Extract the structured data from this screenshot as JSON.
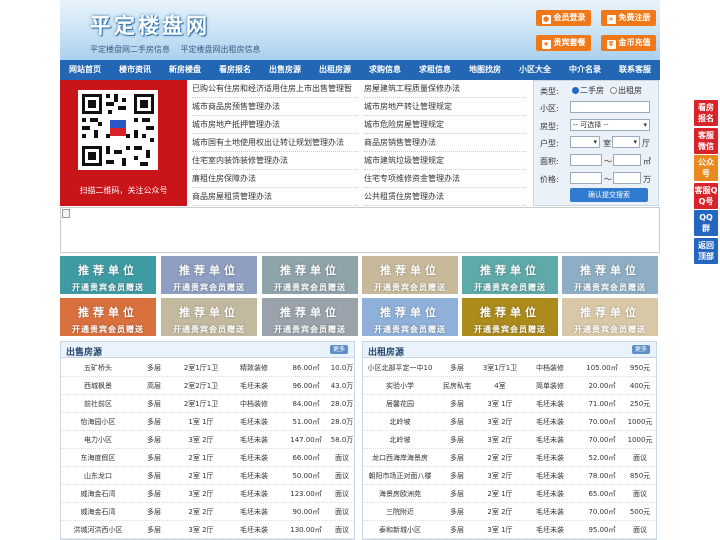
{
  "header": {
    "logo": "平定楼盘网",
    "subtitles": [
      "平定楼盘网二手房信息",
      "平定楼盘网出租房信息"
    ],
    "buttons": [
      {
        "label": "会员登录",
        "icon": "user-icon"
      },
      {
        "label": "免费注册",
        "icon": "register-icon"
      },
      {
        "label": "贵宾套餐",
        "icon": "vip-icon"
      },
      {
        "label": "金币充值",
        "icon": "coin-icon"
      }
    ]
  },
  "nav": [
    "网站首页",
    "楼市资讯",
    "新房楼盘",
    "看房报名",
    "出售房源",
    "出租房源",
    "求购信息",
    "求租信息",
    "地图找房",
    "小区大全",
    "中介名录",
    "联系客服"
  ],
  "qr": {
    "caption": "扫描二维码，关注公众号"
  },
  "links": {
    "left": [
      "已购公有住房和经济适用住房上市出售管理暂",
      "城市商品房预售管理办法",
      "城市房地产抵押管理办法",
      "城市国有土地使用权出让转让规划管理办法",
      "住宅室内装饰装修管理办法",
      "廉租住房保障办法",
      "商品房屋租赁管理办法"
    ],
    "right": [
      "房屋建筑工程质量保修办法",
      "城市房地产转让管理规定",
      "城市危险房屋管理规定",
      "商品房销售管理办法",
      "城市建筑垃圾管理规定",
      "住宅专项维修资金管理办法",
      "公共租赁住房管理办法"
    ]
  },
  "search": {
    "type_label": "类型:",
    "type_options": [
      "二手房",
      "出租房"
    ],
    "community_label": "小区:",
    "style_label": "房型:",
    "style_select": "-- 可选择 --",
    "layout_label": "户型:",
    "layout_unit1": "室",
    "layout_unit2": "厅",
    "area_label": "面积:",
    "area_sep": "～",
    "area_unit": "㎡",
    "price_label": "价格:",
    "price_sep": "～",
    "price_unit": "万",
    "submit": "确认提交搜索"
  },
  "ads": {
    "line1": "推荐单位",
    "line2": "开通贵宾会员赠送",
    "colors": [
      "#3f9ba3",
      "#8e9fc2",
      "#8fa3aa",
      "#c8b99a",
      "#5eaaa8",
      "#8daec4",
      "#d9703e",
      "#c2b99f",
      "#9aa3ab",
      "#8fb0d8",
      "#ad8a1c",
      "#d8c8a8"
    ]
  },
  "sale": {
    "title": "出售房源",
    "more": "更多",
    "rows": [
      [
        "五矿桥头",
        "多层",
        "2室1厅1卫",
        "精致装修",
        "86.00㎡",
        "10.0万"
      ],
      [
        "西城枫景",
        "高层",
        "2室2厅1卫",
        "毛坯未装",
        "96.00㎡",
        "43.0万"
      ],
      [
        "前社前区",
        "多层",
        "2室1厅1卫",
        "中档装修",
        "84.00㎡",
        "28.0万"
      ],
      [
        "怡海园小区",
        "多层",
        "1室 1厅",
        "毛坯未装",
        "51.00㎡",
        "28.0万"
      ],
      [
        "电力小区",
        "多层",
        "3室 2厅",
        "毛坯未装",
        "147.00㎡",
        "58.0万"
      ],
      [
        "东海度假区",
        "多层",
        "2室 1厅",
        "毛坯未装",
        "66.00㎡",
        "面议"
      ],
      [
        "山东龙口",
        "多层",
        "2室 1厅",
        "毛坯未装",
        "50.00㎡",
        "面议"
      ],
      [
        "威海金石湾",
        "多层",
        "3室 2厅",
        "毛坯未装",
        "123.00㎡",
        "面议"
      ],
      [
        "威海金石湾",
        "多层",
        "2室 2厅",
        "毛坯未装",
        "90.00㎡",
        "面议"
      ],
      [
        "洪城河洪西小区",
        "多层",
        "3室 2厅",
        "毛坯未装",
        "130.00㎡",
        "面议"
      ]
    ]
  },
  "rent": {
    "title": "出租房源",
    "more": "更多",
    "rows": [
      [
        "小区北部平定一中10",
        "多层",
        "3室1厅1卫",
        "中档装修",
        "105.00㎡",
        "950元"
      ],
      [
        "实验小学",
        "民房私宅",
        "4室",
        "简单装修",
        "20.00㎡",
        "400元"
      ],
      [
        "居馨花园",
        "多层",
        "3室 1厅",
        "毛坯未装",
        "71.00㎡",
        "250元"
      ],
      [
        "北岭坡",
        "多层",
        "3室 2厅",
        "毛坯未装",
        "70.00㎡",
        "1000元"
      ],
      [
        "北岭坡",
        "多层",
        "3室 2厅",
        "毛坯未装",
        "70.00㎡",
        "1000元"
      ],
      [
        "龙口西海岸海景房",
        "多层",
        "2室 2厅",
        "毛坯未装",
        "52.00㎡",
        "面议"
      ],
      [
        "朝阳市场正对面八楼",
        "多层",
        "3室 2厅",
        "毛坯未装",
        "78.00㎡",
        "850元"
      ],
      [
        "海景房欧洲苑",
        "多层",
        "2室 1厅",
        "毛坯未装",
        "65.00㎡",
        "面议"
      ],
      [
        "三院附近",
        "多层",
        "2室 2厅",
        "毛坯未装",
        "70.00㎡",
        "500元"
      ],
      [
        "泰和新城小区",
        "多层",
        "3室 1厅",
        "毛坯未装",
        "95.00㎡",
        "面议"
      ]
    ]
  },
  "sidebar": [
    {
      "label": "看房报名",
      "color": "#d8232a"
    },
    {
      "label": "客服微信",
      "color": "#d8232a"
    },
    {
      "label": "公众号",
      "color": "#e98a1f"
    },
    {
      "label": "客服QQ号",
      "color": "#d8232a"
    },
    {
      "label": "QQ群",
      "color": "#2566c0"
    },
    {
      "label": "返回顶部",
      "color": "#2566c0"
    }
  ]
}
